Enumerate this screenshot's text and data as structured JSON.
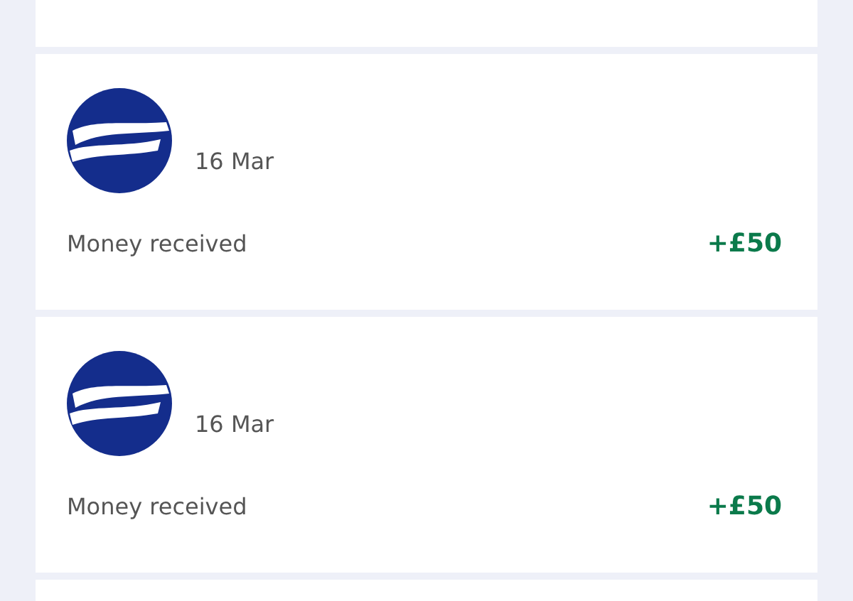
{
  "transactions": [
    {
      "date": "16 Mar",
      "description": "Money received",
      "amount": "+£50"
    },
    {
      "date": "16 Mar",
      "description": "Money received",
      "amount": "+£50"
    }
  ]
}
